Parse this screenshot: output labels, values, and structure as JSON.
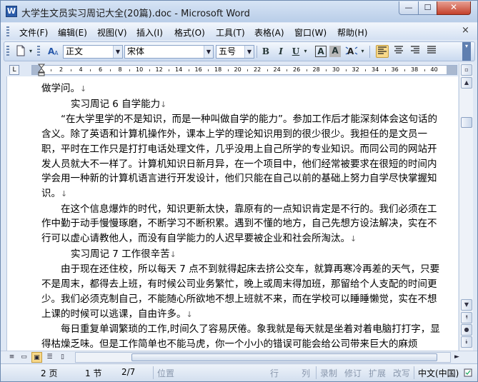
{
  "window": {
    "title": "大学生文员实习周记大全(20篇).doc - Microsoft Word",
    "app_icon": "W",
    "minimize": "—",
    "maximize": "☐",
    "close": "✕"
  },
  "menu": {
    "items": [
      "文件(F)",
      "编辑(E)",
      "视图(V)",
      "插入(I)",
      "格式(O)",
      "工具(T)",
      "表格(A)",
      "窗口(W)",
      "帮助(H)"
    ],
    "close_doc": "×"
  },
  "toolbar": {
    "style_value": "正文",
    "font_value": "宋体",
    "size_value": "五号",
    "bold": "B",
    "italic": "I",
    "underline": "U",
    "aa_border": "A",
    "aa_shade": "A"
  },
  "ruler": {
    "corner": "L",
    "numbers": [
      "2",
      "4",
      "6",
      "8",
      "10",
      "12",
      "14",
      "16",
      "18",
      "20",
      "22",
      "24",
      "26",
      "28",
      "30",
      "32",
      "34",
      "36",
      "38",
      "40"
    ]
  },
  "document": {
    "paragraphs": [
      {
        "text": "做学问。",
        "mark": "↓",
        "style": "plain"
      },
      {
        "text": "实习周记 6 自学能力",
        "mark": "↓",
        "style": "heading"
      },
      {
        "text": "“在大学里学的不是知识，而是一种叫做自学的能力”。参加工作后才能深刻体会这句话的含义。除了英语和计算机操作外，课本上学的理论知识用到的很少很少。我担任的是文员一职，平时在工作只是打打电话处理文件，几乎没用上自己所学的专业知识。而同公司的网站开发人员就大不一样了。计算机知识日新月异，在一个项目中，他们经常被要求在很短的时间内学会用一种新的计算机语言进行开发设计，他们只能在自己以前的基础上努力自学尽快掌握知识。",
        "mark": "↓",
        "style": "indent"
      },
      {
        "text": "在这个信息爆炸的时代，知识更新太快，靠原有的一点知识肯定是不行的。我们必须在工作中勤于动手慢慢琢磨，不断学习不断积累。遇到不懂的地方，自己先想方设法解决，实在不行可以虚心请教他人，而没有自学能力的人迟早要被企业和社会所淘汰。",
        "mark": "↓",
        "style": "indent"
      },
      {
        "text": "实习周记 7 工作很辛苦",
        "mark": "↓",
        "style": "heading"
      },
      {
        "text": "由于现在还住校，所以每天 7 点不到就得起床去挤公交车，就算再寒冷再差的天气，只要不是周末，都得去上班，有时候公司业务繁忙，晚上或周末得加班，那留给个人支配的时间更少。我们必须克制自己，不能随心所欲地不想上班就不来，而在学校可以睡睡懒觉，实在不想上课的时候可以逃课，自由许多。",
        "mark": "↓",
        "style": "indent"
      },
      {
        "text": "每日重复单调繁琐的工作,时间久了容易厌倦。象我就是每天就是坐着对着电脑打打字，显得枯燥乏味。但是工作简单也不能马虎，你一个小小的错误可能会给公司带来巨大的麻烦",
        "mark": "",
        "style": "indent"
      }
    ]
  },
  "status": {
    "page": "2 页",
    "section": "1 节",
    "page_of": "2/7",
    "position": "位置",
    "line": "行",
    "column": "列",
    "rec": "录制",
    "trk": "修订",
    "ext": "扩展",
    "ovr": "改写",
    "language": "中文(中国)"
  }
}
